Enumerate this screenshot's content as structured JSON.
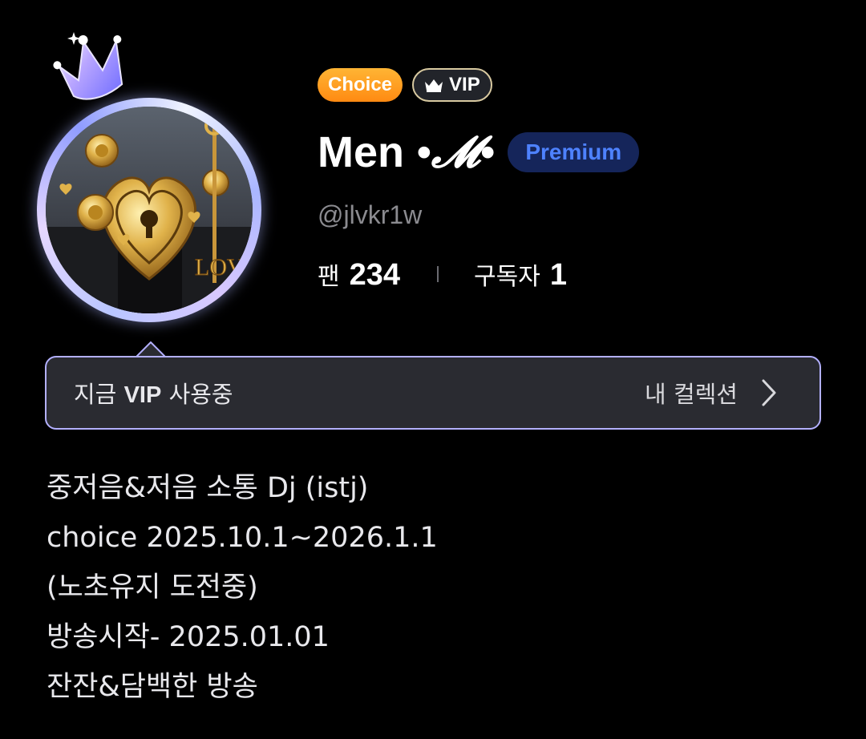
{
  "profile": {
    "badges": {
      "choice_label": "Choice",
      "vip_label": "VIP"
    },
    "name": {
      "text": "Men",
      "decoration": "•𝓜•"
    },
    "premium_label": "Premium",
    "handle": "@jlvkr1w",
    "stats": {
      "fans_label": "팬",
      "fans_value": "234",
      "subscribers_label": "구독자",
      "subscribers_value": "1"
    }
  },
  "vip_banner": {
    "status_prefix": "지금",
    "status_emphasis": "VIP",
    "status_suffix": "사용중",
    "collection_label": "내 컬렉션"
  },
  "bio": {
    "lines": [
      "중저음&저음 소통 Dj (istj)",
      "choice 2025.10.1~2026.1.1",
      "(노초유지 도전중)",
      "방송시작- 2025.01.01",
      "잔잔&담백한 방송"
    ]
  },
  "colors": {
    "background": "#000000",
    "choice_badge": "#ff9a1f",
    "premium_text": "#4e82ff",
    "premium_bg": "#15255a",
    "banner_border": "#b3b0ff",
    "handle_text": "#8b8b90"
  },
  "icons": {
    "crown": "crown-icon",
    "vip_crown": "vip-crown-icon",
    "chevron": "chevron-right-icon"
  }
}
